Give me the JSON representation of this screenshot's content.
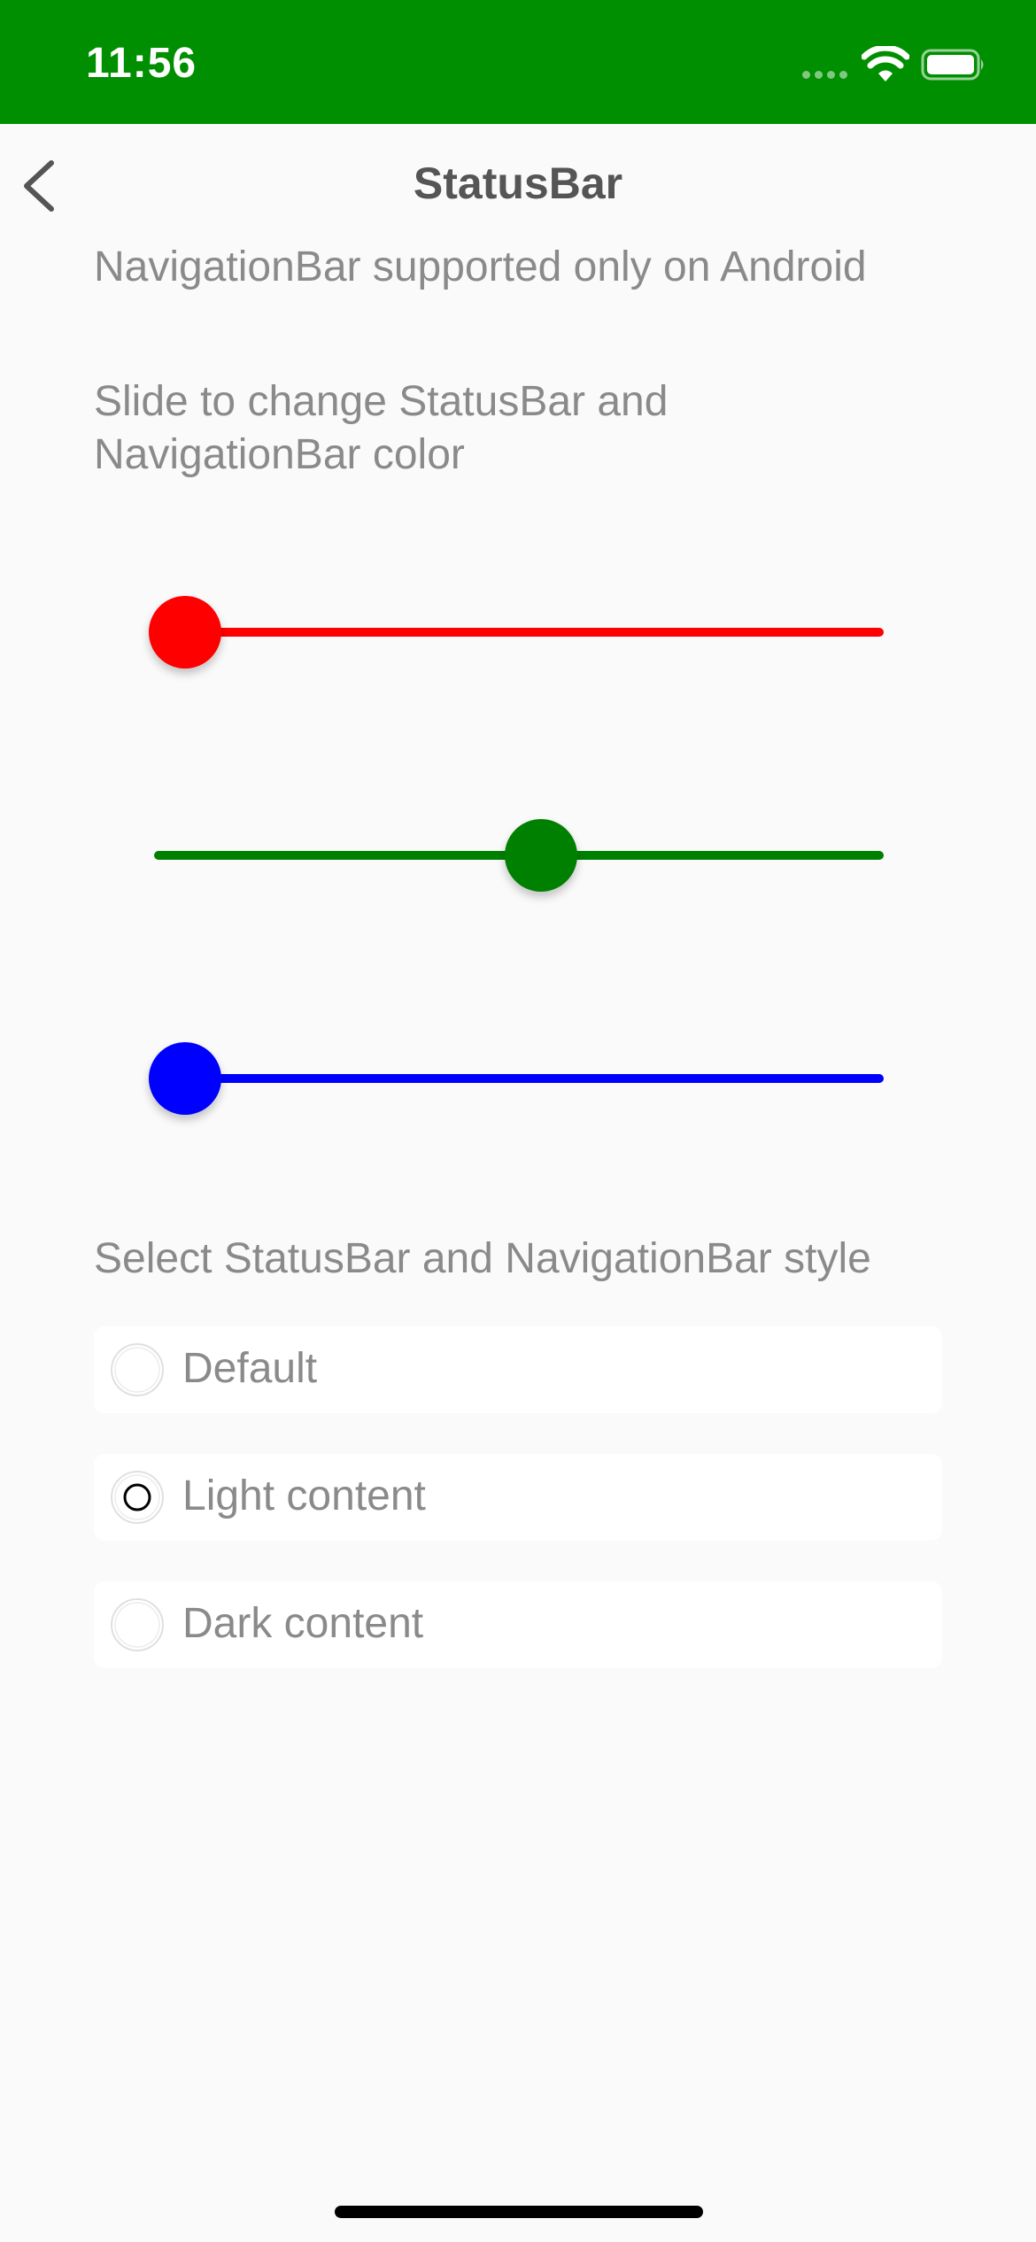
{
  "status_bar": {
    "time": "11:56",
    "background_color": "#008f00"
  },
  "header": {
    "title": "StatusBar",
    "back_icon": "chevron-left-icon"
  },
  "content": {
    "android_note": "NavigationBar supported only on Android",
    "slide_instruction": "Slide to change StatusBar and NavigationBar color",
    "style_heading": "Select StatusBar and NavigationBar style"
  },
  "sliders": [
    {
      "name": "red",
      "color": "#ff0000",
      "value": 0.0
    },
    {
      "name": "green",
      "color": "#008000",
      "value": 0.53
    },
    {
      "name": "blue",
      "color": "#0000ff",
      "value": 0.0
    }
  ],
  "style_options": [
    {
      "label": "Default",
      "selected": false
    },
    {
      "label": "Light content",
      "selected": true
    },
    {
      "label": "Dark content",
      "selected": false
    }
  ]
}
